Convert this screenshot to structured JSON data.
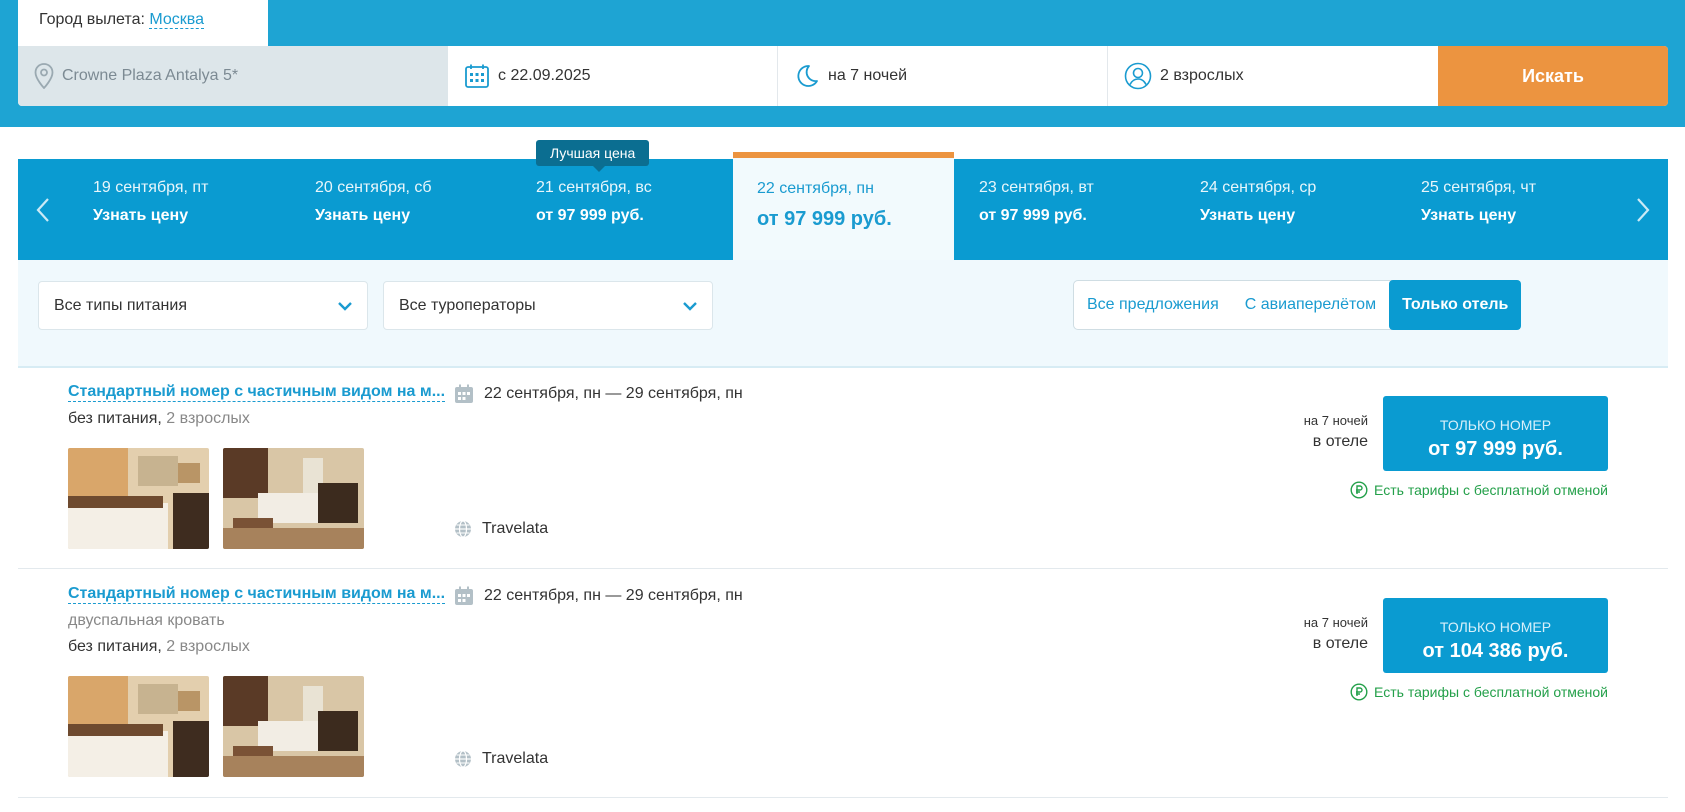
{
  "header": {
    "city_label": "Город вылета:",
    "city_value": "Москва",
    "hotel": "Crowne Plaza Antalya 5*",
    "date": "с 22.09.2025",
    "nights": "на 7 ночей",
    "guests": "2 взрослых",
    "search_label": "Искать"
  },
  "dates": {
    "best_price_badge": "Лучшая цена",
    "items": [
      {
        "label": "19 сентября, пт",
        "price": "Узнать цену"
      },
      {
        "label": "20 сентября, сб",
        "price": "Узнать цену"
      },
      {
        "label": "21 сентября, вс",
        "price": "от 97 999 руб."
      },
      {
        "label": "22 сентября, пн",
        "price": "от 97 999 руб."
      },
      {
        "label": "23 сентября, вт",
        "price": "от 97 999 руб."
      },
      {
        "label": "24 сентября, ср",
        "price": "Узнать цену"
      },
      {
        "label": "25 сентября, чт",
        "price": "Узнать цену"
      }
    ],
    "active_index": 3
  },
  "filters": {
    "meal": "Все типы питания",
    "operator": "Все туроператоры",
    "segments": [
      "Все предложения",
      "С авиаперелётом",
      "Только отель"
    ],
    "active_segment": 2
  },
  "offers": [
    {
      "title": "Стандартный номер с частичным видом на м...",
      "bed": "",
      "meal": "без питания,",
      "guests": "2 взрослых",
      "dates": "22 сентября, пн — 29 сентября, пн",
      "operator": "Travelata",
      "nights": "на 7 ночей",
      "place": "в отеле",
      "price_caption": "ТОЛЬКО НОМЕР",
      "price": "от 97 999 руб.",
      "free_cancel": "Есть тарифы с бесплатной отменой"
    },
    {
      "title": "Стандартный номер с частичным видом на м...",
      "bed": "двуспальная кровать",
      "meal": "без питания,",
      "guests": "2 взрослых",
      "dates": "22 сентября, пн — 29 сентября, пн",
      "operator": "Travelata",
      "nights": "на 7 ночей",
      "place": "в отеле",
      "price_caption": "ТОЛЬКО НОМЕР",
      "price": "от 104 386 руб.",
      "free_cancel": "Есть тарифы с бесплатной отменой"
    }
  ],
  "colors": {
    "header_blue": "#1ea4d3",
    "accent_blue": "#0a9bd1",
    "orange": "#ec9440",
    "green": "#24a04a"
  }
}
